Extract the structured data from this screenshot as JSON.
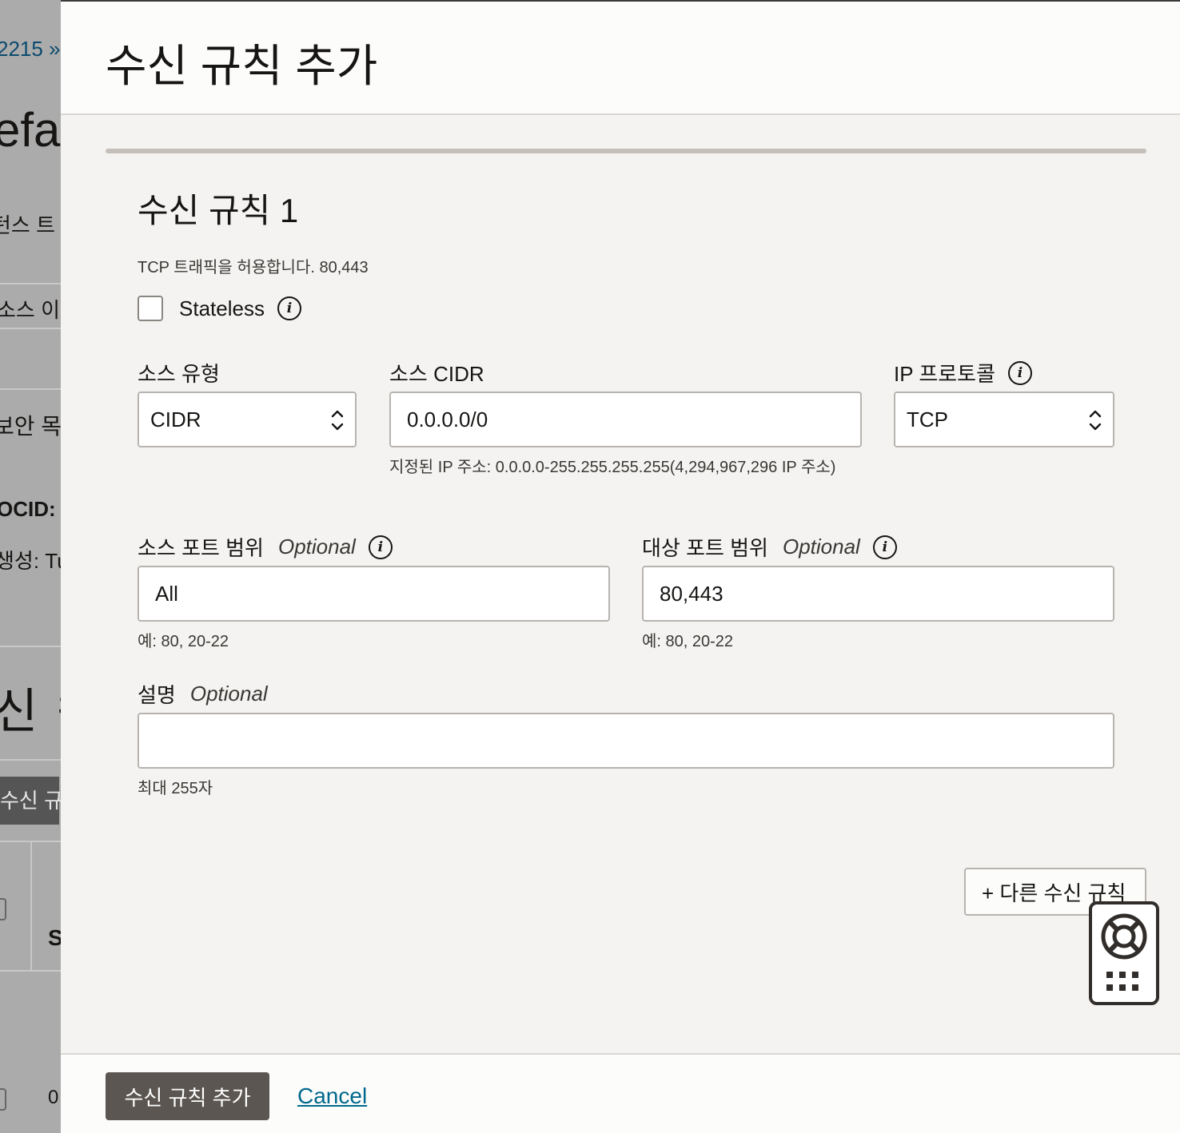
{
  "background": {
    "breadcrumb": "2215 »",
    "title_fragment": "efau",
    "text1": "턴스 트",
    "text2": "소스 이",
    "text3": "보안 목",
    "ocid_label": "OCID:",
    "created_label": "생성: Tu",
    "section_title": "신 ㅋ",
    "button_fragment": "수신 규칙",
    "column_fragment": "S",
    "row_value": "0"
  },
  "dialog": {
    "title": "수신 규칙 추가",
    "rule": {
      "title": "수신 규칙 1",
      "summary": "TCP 트래픽을 허용합니다. 80,443",
      "stateless": {
        "label": "Stateless",
        "checked": false
      },
      "source_type": {
        "label": "소스 유형",
        "value": "CIDR"
      },
      "source_cidr": {
        "label": "소스 CIDR",
        "value": "0.0.0.0/0",
        "hint": "지정된 IP 주소: 0.0.0.0-255.255.255.255(4,294,967,296 IP 주소)"
      },
      "ip_protocol": {
        "label": "IP 프로토콜",
        "value": "TCP"
      },
      "source_port": {
        "label": "소스 포트 범위",
        "optional": "Optional",
        "value": "All",
        "hint": "예: 80, 20-22"
      },
      "dest_port": {
        "label": "대상 포트 범위",
        "optional": "Optional",
        "value": "80,443",
        "hint": "예: 80, 20-22"
      },
      "description": {
        "label": "설명",
        "optional": "Optional",
        "value": "",
        "hint": "최대 255자"
      }
    },
    "another_rule_button": "+ 다른 수신 규칙",
    "footer": {
      "primary_button": "수신 규칙 추가",
      "cancel_link": "Cancel"
    }
  },
  "icons": {
    "info": "info-icon",
    "select_chevron": "chevron-up-down-icon",
    "help": "lifebuoy-icon",
    "apps": "grid-dots-icon"
  },
  "colors": {
    "primary_button": "#5b5651",
    "link": "#00688c",
    "dialog_bg": "#f4f3f1"
  }
}
